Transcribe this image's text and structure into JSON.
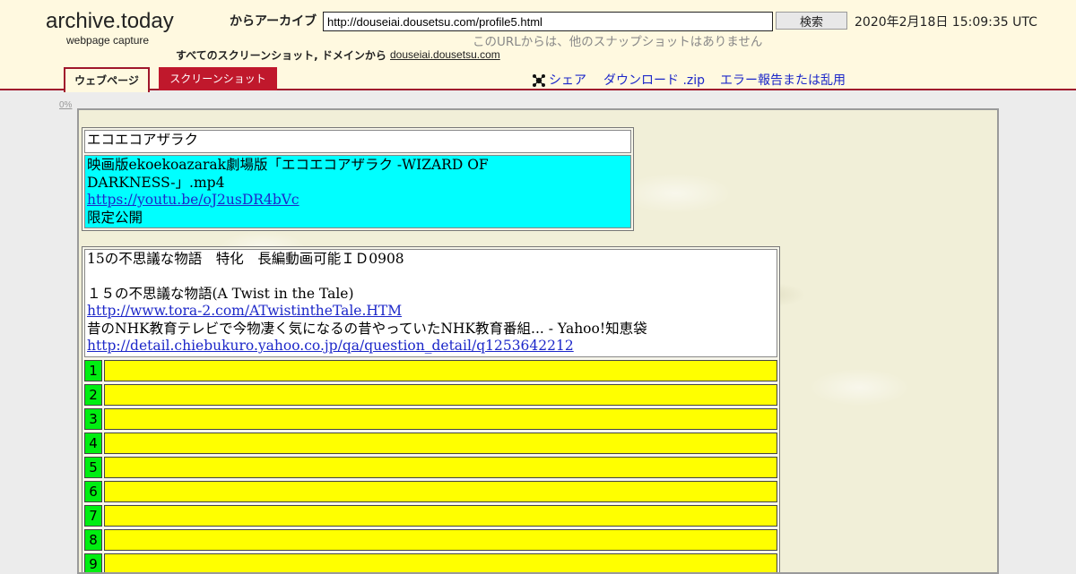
{
  "header": {
    "logo_title": "archive.today",
    "logo_sub": "webpage capture",
    "archive_label": "からアーカイブ",
    "url_value": "http://douseiai.dousetsu.com/profile5.html",
    "search_button": "検索",
    "capture_date": "2020年2月18日 15:09:35 UTC",
    "no_snapshots": "このURLからは、他のスナップショットはありません",
    "all_screens_label": "すべてのスクリーンショット, ドメインから",
    "domain_link": "douseiai.dousetsu.com",
    "tabs": [
      {
        "label": "ウェブページ",
        "active": true
      },
      {
        "label": "スクリーンショット",
        "active": false
      }
    ],
    "actions": {
      "share": "シェア",
      "download": "ダウンロード .zip",
      "report": "エラー報告または乱用"
    },
    "accent_color": "#a0172c"
  },
  "content": {
    "zoom": "0%",
    "table1": {
      "title": "エコエコアザラク",
      "line1": "映画版ekoekoazarak劇場版「エコエコアザラク -WIZARD OF DARKNESS-」.mp4",
      "link": "https://youtu.be/oJ2usDR4bVc",
      "line3": "限定公開"
    },
    "table2": {
      "title": "15の不思議な物語　特化　長編動画可能ＩＤ0908",
      "subtitle": "１５の不思議な物語(A Twist in the Tale)",
      "link1": "http://www.tora-2.com/ATwistintheTale.HTM",
      "desc": "昔のNHK教育テレビで今物凄く気になるの昔やっていたNHK教育番組... - Yahoo!知恵袋",
      "link2": "http://detail.chiebukuro.yahoo.co.jp/qa/question_detail/q1253642212",
      "rows": [
        "1",
        "2",
        "3",
        "4",
        "5",
        "6",
        "7",
        "8",
        "9"
      ]
    }
  }
}
